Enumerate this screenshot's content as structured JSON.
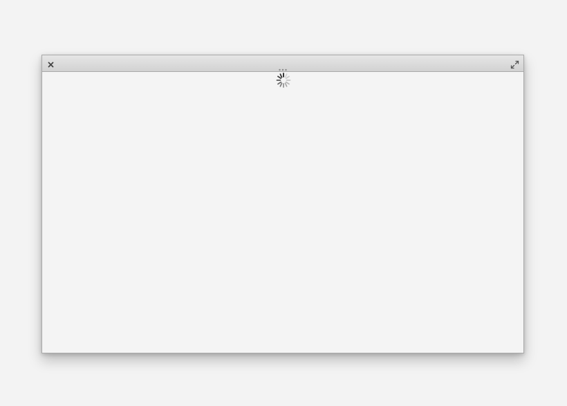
{
  "window": {
    "title": "",
    "state": "loading",
    "colors": {
      "titlebar_top": "#e6e6e6",
      "titlebar_bottom": "#d2d2d2",
      "content_background": "#f4f4f4",
      "desktop_background": "#f3f3f3",
      "icon": "#555555"
    }
  },
  "titlebar": {
    "close_icon": "close-icon",
    "grip_icon": "drag-grip-icon",
    "maximize_icon": "maximize-icon"
  },
  "content": {
    "spinner_icon": "loading-spinner-icon"
  }
}
